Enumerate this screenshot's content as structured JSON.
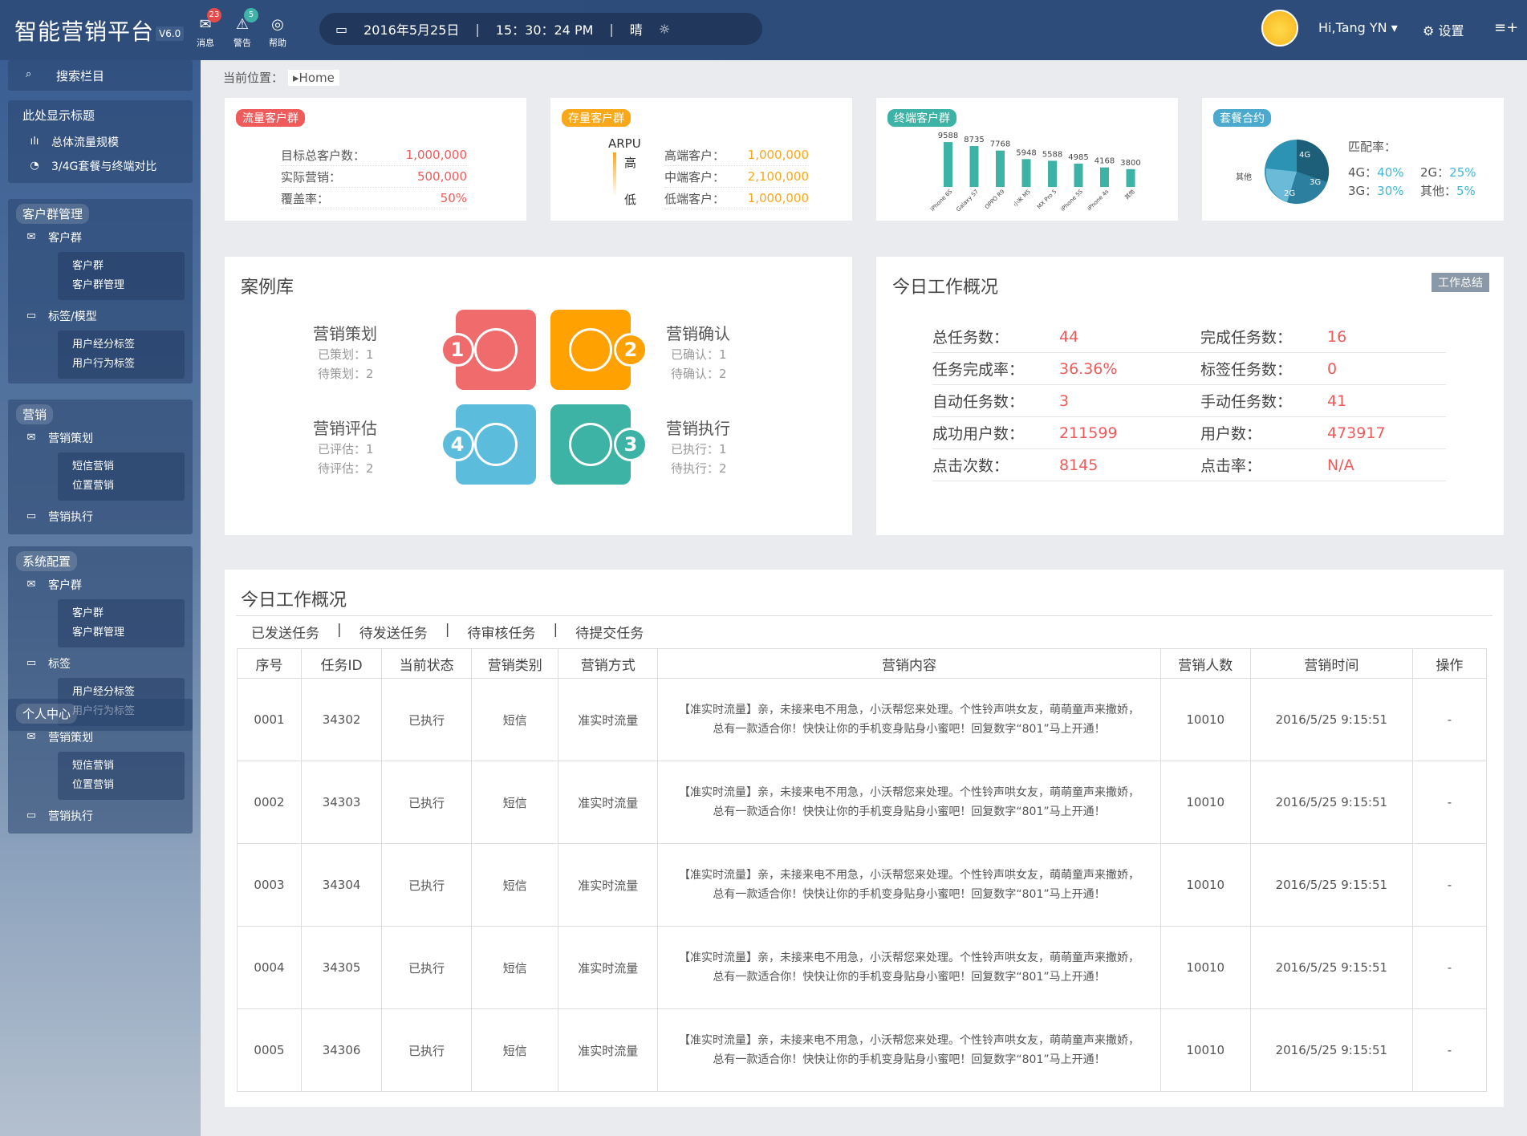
{
  "header": {
    "brand": "智能营销平台",
    "version": "V6.0",
    "icons": [
      {
        "label": "消息",
        "badge": "23",
        "color": "#e54b4b",
        "icon": "message-icon"
      },
      {
        "label": "警告",
        "badge": "5",
        "color": "#3fb3a8",
        "icon": "warning-icon"
      },
      {
        "label": "帮助",
        "badge": "",
        "color": "",
        "icon": "help-icon"
      }
    ],
    "date": "2016年5月25日",
    "time": "15：30：24 PM",
    "weather": "晴",
    "user": "Hi,Tang YN",
    "settings": "设置"
  },
  "sidebar": {
    "search": "搜索栏目",
    "display_title": "此处显示标题",
    "display_items": [
      "总体流量规模",
      "3/4G套餐与终端对比"
    ],
    "sections": [
      {
        "title": "客户群管理",
        "items": [
          {
            "label": "客户群",
            "icon": "mail-icon",
            "sub": [
              "客户群",
              "客户群管理"
            ]
          },
          {
            "label": "标签/模型",
            "icon": "window-icon",
            "sub": [
              "用户经分标签",
              "用户行为标签"
            ]
          }
        ]
      },
      {
        "title": "营销",
        "items": [
          {
            "label": "营销策划",
            "icon": "mail-icon",
            "sub": [
              "短信营销",
              "位置营销"
            ]
          },
          {
            "label": "营销执行",
            "icon": "window-icon",
            "sub": []
          }
        ]
      },
      {
        "title": "系统配置",
        "items": [
          {
            "label": "客户群",
            "icon": "mail-icon",
            "sub": [
              "客户群",
              "客户群管理"
            ]
          },
          {
            "label": "标签",
            "icon": "window-icon",
            "sub": [
              "用户经分标签",
              "用户行为标签"
            ]
          }
        ]
      },
      {
        "title": "个人中心",
        "items": [
          {
            "label": "营销策划",
            "icon": "mail-icon",
            "sub": [
              "短信营销",
              "位置营销"
            ]
          },
          {
            "label": "营销执行",
            "icon": "window-icon",
            "sub": []
          }
        ]
      }
    ]
  },
  "breadcrumb": {
    "label": "当前位置：",
    "home": "Home"
  },
  "cards": {
    "flow": {
      "tag": "流量客户群",
      "rows": [
        {
          "k": "目标总客户数：",
          "v": "1,000,000"
        },
        {
          "k": "实际营销：",
          "v": "500,000"
        },
        {
          "k": "覆盖率：",
          "v": "50%"
        }
      ]
    },
    "stock": {
      "tag": "存量客户群",
      "arpu": "ARPU",
      "high": "高",
      "low": "低",
      "rows": [
        {
          "k": "高端客户：",
          "v": "1,000,000"
        },
        {
          "k": "中端客户：",
          "v": "2,100,000"
        },
        {
          "k": "低端客户：",
          "v": "1,000,000"
        }
      ]
    },
    "terminal": {
      "tag": "终端客户群"
    },
    "plan": {
      "tag": "套餐合约",
      "match": "匹配率：",
      "items": [
        {
          "k": "4G：",
          "v": "40%"
        },
        {
          "k": "2G：",
          "v": "25%"
        },
        {
          "k": "3G：",
          "v": "30%"
        },
        {
          "k": "其他：",
          "v": "5%"
        }
      ],
      "pie_labels": [
        "4G",
        "3G",
        "2G",
        "其他"
      ]
    }
  },
  "chart_data": {
    "type": "bar",
    "categories": [
      "iPhone 6S",
      "Galaxy S7",
      "OPPO R9",
      "小米 M5",
      "MX Pro 5",
      "iPhone 5S",
      "iPhone 4s",
      "其他"
    ],
    "values": [
      9588,
      8735,
      7768,
      5948,
      5588,
      4985,
      4168,
      3800
    ],
    "ylim": [
      0,
      10000
    ]
  },
  "cases": {
    "title": "案例库",
    "steps": [
      {
        "num": "1",
        "title": "营销策划",
        "l1": "已策划：1",
        "l2": "待策划：2",
        "color": "#f06b6b"
      },
      {
        "num": "2",
        "title": "营销确认",
        "l1": "已确认：1",
        "l2": "待确认：2",
        "color": "#ffa100"
      },
      {
        "num": "3",
        "title": "营销执行",
        "l1": "已执行：1",
        "l2": "待执行：2",
        "color": "#3cb3a4"
      },
      {
        "num": "4",
        "title": "营销评估",
        "l1": "已评估：1",
        "l2": "待评估：2",
        "color": "#5bbcdc"
      }
    ]
  },
  "today": {
    "title": "今日工作概况",
    "button": "工作总结",
    "stats": [
      {
        "k": "总任务数：",
        "v": "44"
      },
      {
        "k": "完成任务数：",
        "v": "16"
      },
      {
        "k": "任务完成率：",
        "v": "36.36%"
      },
      {
        "k": "标签任务数：",
        "v": "0"
      },
      {
        "k": "自动任务数：",
        "v": "3"
      },
      {
        "k": "手动任务数：",
        "v": "41"
      },
      {
        "k": "成功用户数：",
        "v": "211599"
      },
      {
        "k": "用户数：",
        "v": "473917"
      },
      {
        "k": "点击次数：",
        "v": "8145"
      },
      {
        "k": "点击率：",
        "v": "N/A"
      }
    ]
  },
  "table": {
    "title": "今日工作概况",
    "tabs": [
      "已发送任务",
      "待发送任务",
      "待审核任务",
      "待提交任务"
    ],
    "headers": [
      "序号",
      "任务ID",
      "当前状态",
      "营销类别",
      "营销方式",
      "营销内容",
      "营销人数",
      "营销时间",
      "操作"
    ],
    "rows": [
      [
        "0001",
        "34302",
        "已执行",
        "短信",
        "准实时流量",
        "【准实时流量】亲，未接来电不用急，小沃帮您来处理。个性铃声哄女友，萌萌童声来撒娇，总有一款适合你！快快让你的手机变身贴身小蜜吧！回复数字“801”马上开通！",
        "10010",
        "2016/5/25 9:15:51",
        "-"
      ],
      [
        "0002",
        "34303",
        "已执行",
        "短信",
        "准实时流量",
        "【准实时流量】亲，未接来电不用急，小沃帮您来处理。个性铃声哄女友，萌萌童声来撒娇，总有一款适合你！快快让你的手机变身贴身小蜜吧！回复数字“801”马上开通！",
        "10010",
        "2016/5/25 9:15:51",
        "-"
      ],
      [
        "0003",
        "34304",
        "已执行",
        "短信",
        "准实时流量",
        "【准实时流量】亲，未接来电不用急，小沃帮您来处理。个性铃声哄女友，萌萌童声来撒娇，总有一款适合你！快快让你的手机变身贴身小蜜吧！回复数字“801”马上开通！",
        "10010",
        "2016/5/25 9:15:51",
        "-"
      ],
      [
        "0004",
        "34305",
        "已执行",
        "短信",
        "准实时流量",
        "【准实时流量】亲，未接来电不用急，小沃帮您来处理。个性铃声哄女友，萌萌童声来撒娇，总有一款适合你！快快让你的手机变身贴身小蜜吧！回复数字“801”马上开通！",
        "10010",
        "2016/5/25 9:15:51",
        "-"
      ],
      [
        "0005",
        "34306",
        "已执行",
        "短信",
        "准实时流量",
        "【准实时流量】亲，未接来电不用急，小沃帮您来处理。个性铃声哄女友，萌萌童声来撒娇，总有一款适合你！快快让你的手机变身贴身小蜜吧！回复数字“801”马上开通！",
        "10010",
        "2016/5/25 9:15:51",
        "-"
      ]
    ]
  }
}
